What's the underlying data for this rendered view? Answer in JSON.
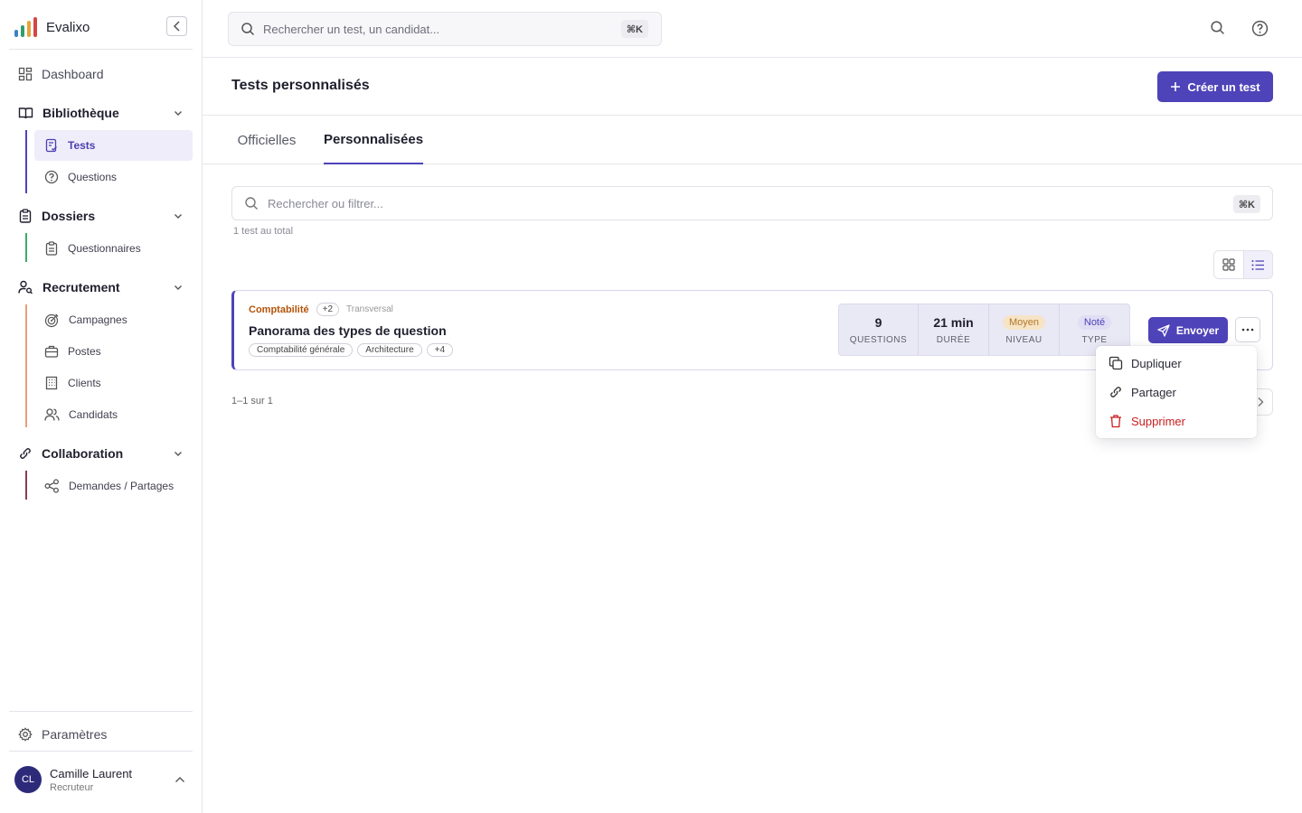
{
  "app": {
    "name": "Evalixo"
  },
  "colors": {
    "accent": "#4e43b8",
    "danger": "#c81e1e",
    "category": "#b45309"
  },
  "sidebar": {
    "dashboard": "Dashboard",
    "sections": [
      {
        "label": "Bibliothèque",
        "items": [
          {
            "label": "Tests",
            "icon": "test-list-icon",
            "active": true
          },
          {
            "label": "Questions",
            "icon": "question-icon"
          }
        ]
      },
      {
        "label": "Dossiers",
        "items": [
          {
            "label": "Questionnaires",
            "icon": "clipboard-icon"
          }
        ]
      },
      {
        "label": "Recrutement",
        "items": [
          {
            "label": "Campagnes",
            "icon": "target-icon"
          },
          {
            "label": "Postes",
            "icon": "briefcase-icon"
          },
          {
            "label": "Clients",
            "icon": "building-icon"
          },
          {
            "label": "Candidats",
            "icon": "users-icon"
          }
        ]
      },
      {
        "label": "Collaboration",
        "items": [
          {
            "label": "Demandes / Partages",
            "icon": "share-icon"
          }
        ]
      }
    ],
    "settings": "Paramètres",
    "user": {
      "initials": "CL",
      "name": "Camille Laurent",
      "role": "Recruteur"
    }
  },
  "topbar": {
    "search_placeholder": "Rechercher un test, un candidat...",
    "shortcut": "⌘K"
  },
  "page": {
    "title": "Tests personnalisés",
    "create_label": "Créer un test"
  },
  "tabs": [
    {
      "label": "Officielles"
    },
    {
      "label": "Personnalisées",
      "active": true
    }
  ],
  "filter": {
    "placeholder": "Rechercher ou filtrer...",
    "shortcut": "⌘K",
    "count_text": "1 test au total"
  },
  "card": {
    "category": "Comptabilité",
    "category_more": "+2",
    "scope": "Transversal",
    "title": "Panorama des types de question",
    "tags": [
      "Comptabilité générale",
      "Architecture",
      "+4"
    ],
    "stats": {
      "questions_value": "9",
      "questions_label": "QUESTIONS",
      "duration_value": "21 min",
      "duration_label": "DURÉE",
      "level_value": "Moyen",
      "level_label": "NIVEAU",
      "type_value": "Noté",
      "type_label": "TYPE"
    },
    "send_label": "Envoyer"
  },
  "pagination": {
    "text": "1–1 sur 1"
  },
  "menu": {
    "items": [
      "Dupliquer",
      "Partager",
      "Supprimer"
    ]
  }
}
